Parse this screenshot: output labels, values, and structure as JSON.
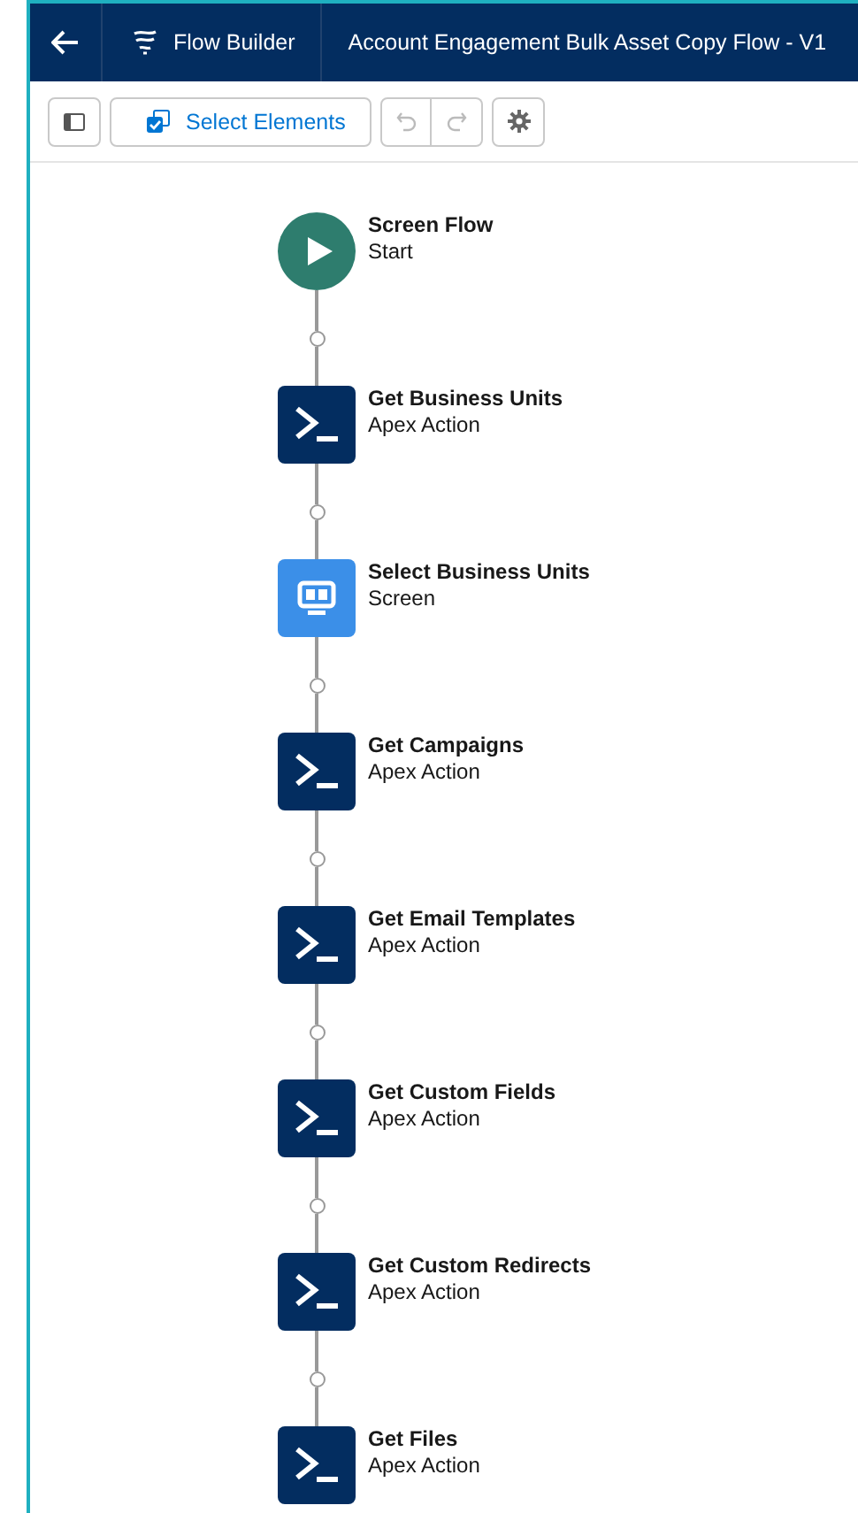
{
  "header": {
    "app_name": "Flow Builder",
    "title": "Account Engagement Bulk Asset Copy Flow - V1"
  },
  "toolbar": {
    "select_button": "Select Elements"
  },
  "flow": [
    {
      "kind": "start",
      "label": "Screen Flow",
      "type": "Start"
    },
    {
      "kind": "action",
      "label": "Get Business Units",
      "type": "Apex Action"
    },
    {
      "kind": "screen",
      "label": "Select Business Units",
      "type": "Screen"
    },
    {
      "kind": "action",
      "label": "Get Campaigns",
      "type": "Apex Action"
    },
    {
      "kind": "action",
      "label": "Get Email Templates",
      "type": "Apex Action"
    },
    {
      "kind": "action",
      "label": "Get Custom Fields",
      "type": "Apex Action"
    },
    {
      "kind": "action",
      "label": "Get Custom Redirects",
      "type": "Apex Action"
    },
    {
      "kind": "action",
      "label": "Get Files",
      "type": "Apex Action"
    }
  ]
}
